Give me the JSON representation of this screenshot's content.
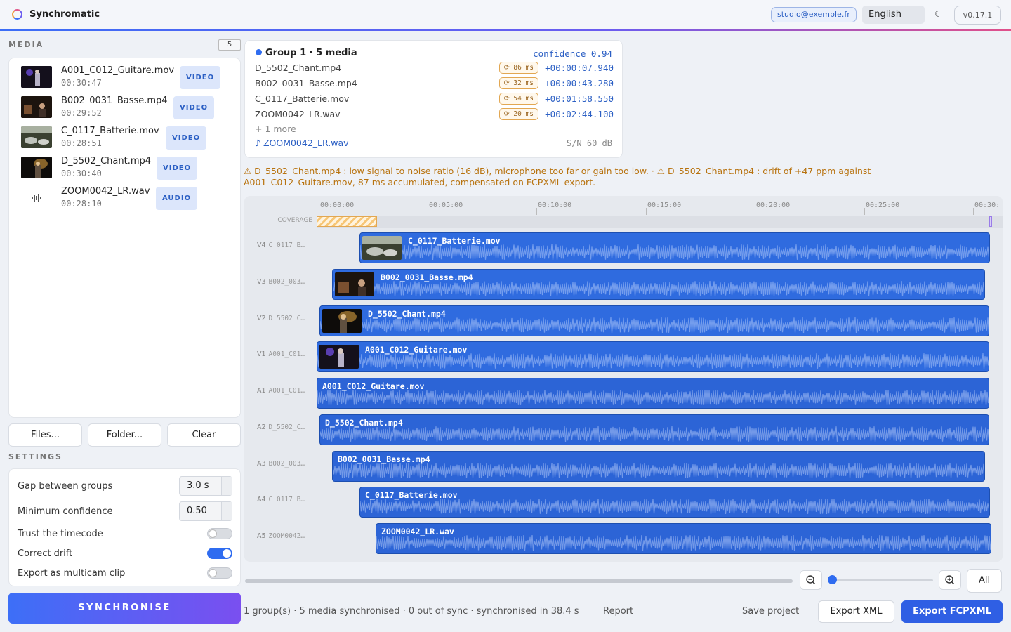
{
  "app": {
    "name": "Synchromatic",
    "user": "studio@exemple.fr",
    "language": "English",
    "version": "v0.17.1"
  },
  "media": {
    "label": "MEDIA",
    "count": "5",
    "items": [
      {
        "name": "A001_C012_Guitare.mov",
        "duration": "00:30:47",
        "type": "VIDEO"
      },
      {
        "name": "B002_0031_Basse.mp4",
        "duration": "00:29:52",
        "type": "VIDEO"
      },
      {
        "name": "C_0117_Batterie.mov",
        "duration": "00:28:51",
        "type": "VIDEO"
      },
      {
        "name": "D_5502_Chant.mp4",
        "duration": "00:30:40",
        "type": "VIDEO"
      },
      {
        "name": "ZOOM0042_LR.wav",
        "duration": "00:28:10",
        "type": "AUDIO"
      }
    ],
    "buttons": {
      "files": "Files...",
      "folder": "Folder...",
      "clear": "Clear"
    }
  },
  "settings": {
    "label": "SETTINGS",
    "gap_label": "Gap between groups",
    "gap_value": "3.0 s",
    "confidence_label": "Minimum confidence",
    "confidence_value": "0.50",
    "trust_timecode_label": "Trust the timecode",
    "trust_timecode": false,
    "correct_drift_label": "Correct drift",
    "correct_drift": true,
    "multicam_label": "Export as multicam clip",
    "multicam": false
  },
  "synchronise_label": "SYNCHRONISE",
  "group": {
    "title": "Group 1 · 5 media",
    "confidence": "confidence 0.94",
    "rows": [
      {
        "name": "D_5502_Chant.mp4",
        "ms": "⟳ 86 ms",
        "offset": "+00:00:07.940"
      },
      {
        "name": "B002_0031_Basse.mp4",
        "ms": "⟳ 32 ms",
        "offset": "+00:00:43.280"
      },
      {
        "name": "C_0117_Batterie.mov",
        "ms": "⟳ 54 ms",
        "offset": "+00:01:58.550"
      },
      {
        "name": "ZOOM0042_LR.wav",
        "ms": "⟳ 20 ms",
        "offset": "+00:02:44.100"
      }
    ],
    "more": "+ 1 more",
    "reference": "♪ ZOOM0042_LR.wav",
    "sn": "S/N 60 dB"
  },
  "warning": "⚠ D_5502_Chant.mp4 : low signal to noise ratio (16 dB), microphone too far or gain too low.  ·  ⚠ D_5502_Chant.mp4 : drift of +47 ppm against A001_C012_Guitare.mov, 87 ms accumulated, compensated on FCPXML export.",
  "timeline": {
    "ticks": [
      "00:00:00",
      "00:05:00",
      "00:10:00",
      "00:15:00",
      "00:20:00",
      "00:25:00",
      "00:30:"
    ],
    "coverage_label": "COVERAGE",
    "tracks": [
      {
        "id": "V4",
        "file": "C_0117_B…",
        "clip": "C_0117_Batterie.mov"
      },
      {
        "id": "V3",
        "file": "B002_003…",
        "clip": "B002_0031_Basse.mp4"
      },
      {
        "id": "V2",
        "file": "D_5502_C…",
        "clip": "D_5502_Chant.mp4"
      },
      {
        "id": "V1",
        "file": "A001_C01…",
        "clip": "A001_C012_Guitare.mov"
      },
      {
        "id": "A1",
        "file": "A001_C01…",
        "clip": "A001_C012_Guitare.mov"
      },
      {
        "id": "A2",
        "file": "D_5502_C…",
        "clip": "D_5502_Chant.mp4"
      },
      {
        "id": "A3",
        "file": "B002_003…",
        "clip": "B002_0031_Basse.mp4"
      },
      {
        "id": "A4",
        "file": "C_0117_B…",
        "clip": "C_0117_Batterie.mov"
      },
      {
        "id": "A5",
        "file": "ZOOM0042…",
        "clip": "ZOOM0042_LR.wav"
      }
    ],
    "zoom_all": "All"
  },
  "footer": {
    "status": "1 group(s) · 5 media synchronised · 0 out of sync  ·  synchronised in 38.4 s",
    "report": "Report",
    "save_project": "Save project",
    "export_xml": "Export XML",
    "export_fcpxml": "Export FCPXML"
  },
  "colors": {
    "accent": "#2f6cf0",
    "clip": "#2f6bdf",
    "warning": "#b8730f"
  }
}
